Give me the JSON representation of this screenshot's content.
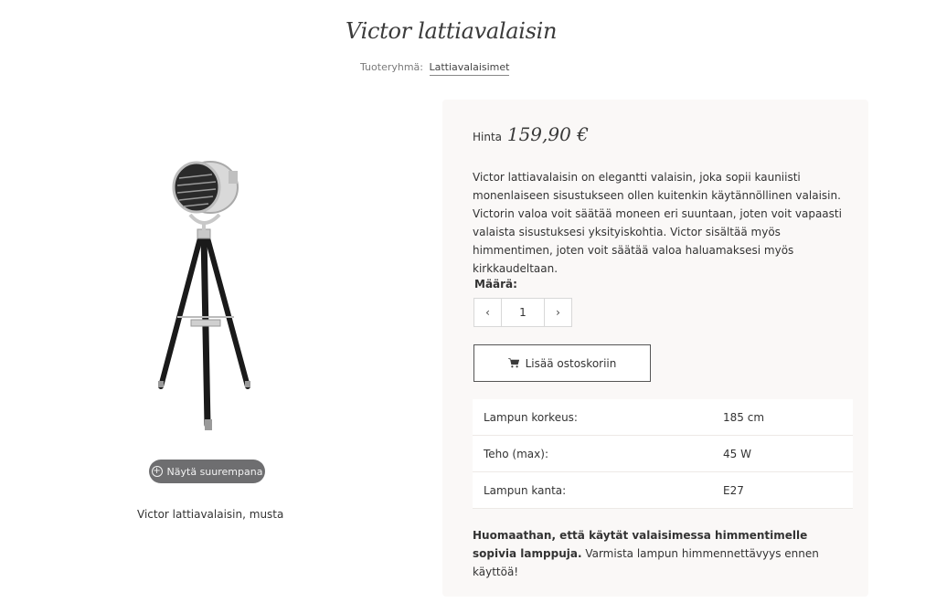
{
  "product": {
    "title": "Victor lattiavalaisin",
    "caption": "Victor lattiavalaisin, musta"
  },
  "breadcrumb": {
    "label": "Tuoteryhmä:",
    "link": "Lattiavalaisimet"
  },
  "gallery": {
    "zoom_label": "Näytä suurempana"
  },
  "price": {
    "label": "Hinta",
    "amount": "159,90 €"
  },
  "description": "Victor lattiavalaisin on elegantti valaisin, joka sopii kauniisti monenlaiseen sisustukseen ollen kuitenkin käytännöllinen valaisin. Victorin valoa voit säätää moneen eri suuntaan, joten voit vapaasti valaista sisustuksesi yksityiskohtia. Victor sisältää myös himmentimen, joten voit säätää valoa haluamaksesi myös kirkkaudeltaan.",
  "quantity": {
    "label": "Määrä:",
    "value": "1",
    "decrement": "‹",
    "increment": "›"
  },
  "cart": {
    "label": "Lisää ostoskoriin",
    "icon": "cart-icon"
  },
  "specs": [
    {
      "key": "Lampun korkeus:",
      "value": "185 cm"
    },
    {
      "key": "Teho (max):",
      "value": "45 W"
    },
    {
      "key": "Lampun kanta:",
      "value": "E27"
    }
  ],
  "note": {
    "bold": "Huomaathan, että käytät valaisimessa himmentimelle sopivia lamppuja.",
    "rest": " Varmista lampun himmennettävyys ennen käyttöä!"
  },
  "colors": {
    "panel_bg": "#faf8f7",
    "zoom_button_bg": "#6e6e70",
    "lamp_black": "#1a1a1a",
    "lamp_chrome": "#c8c8c8"
  }
}
